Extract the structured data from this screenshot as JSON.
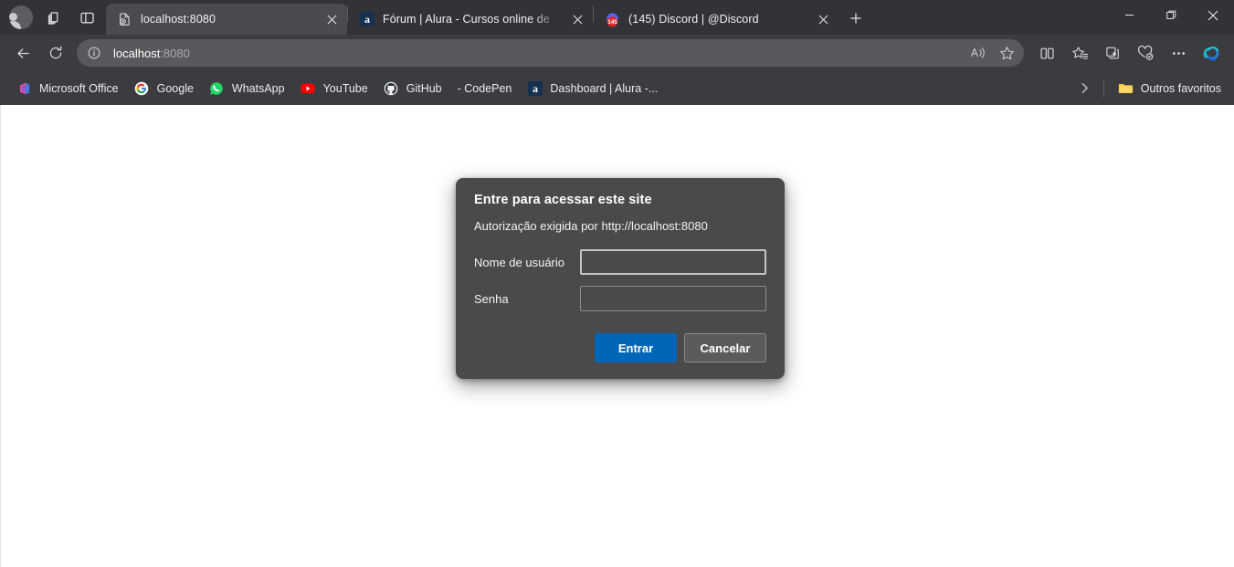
{
  "window": {
    "controls": {
      "minimize": "Minimizar",
      "restore": "Restaurar",
      "close": "Fechar"
    }
  },
  "tabstrip": {
    "profile_label": "Perfil",
    "workspaces_label": "Espaços de trabalho",
    "tab_actions_label": "Ações da guia",
    "new_tab_label": "Nova guia",
    "tabs": [
      {
        "title": "localhost:8080",
        "favicon": "page-error-icon",
        "active": true,
        "close_label": "Fechar guia"
      },
      {
        "title": "Fórum | Alura - Cursos online de",
        "favicon": "alura-icon",
        "active": false,
        "close_label": "Fechar guia"
      },
      {
        "title": "(145) Discord | @Discord",
        "favicon": "discord-icon",
        "badge": "145",
        "active": false,
        "close_label": "Fechar guia"
      }
    ]
  },
  "toolbar": {
    "back_label": "Voltar",
    "refresh_label": "Atualizar",
    "omnibox": {
      "info_label": "Exibir informações do site",
      "url_host": "localhost",
      "url_port": ":8080",
      "read_aloud_label": "Ler em voz alta",
      "favorite_label": "Adicionar esta página aos favoritos"
    },
    "split_screen_label": "Tela dividida",
    "favorites_label": "Favoritos",
    "collections_label": "Coleções",
    "browser_essentials_label": "Browser essentials",
    "settings_label": "Configurações e mais",
    "copilot_label": "Copilot"
  },
  "bookmarks": {
    "items": [
      {
        "label": "Microsoft Office",
        "icon": "office-icon"
      },
      {
        "label": "Google",
        "icon": "google-icon"
      },
      {
        "label": "WhatsApp",
        "icon": "whatsapp-icon"
      },
      {
        "label": "YouTube",
        "icon": "youtube-icon"
      },
      {
        "label": "GitHub",
        "icon": "github-icon"
      },
      {
        "label": "- CodePen",
        "icon": "codepen-icon"
      },
      {
        "label": "Dashboard | Alura -...",
        "icon": "alura-icon"
      }
    ],
    "overflow_label": "Mostrar mais favoritos",
    "other_favorites": {
      "label": "Outros favoritos",
      "icon": "folder-icon"
    }
  },
  "auth_dialog": {
    "title": "Entre para acessar este site",
    "subtitle": "Autorização exigida por http://localhost:8080",
    "username": {
      "label": "Nome de usuário",
      "value": "",
      "placeholder": "",
      "focused": true
    },
    "password": {
      "label": "Senha",
      "value": "",
      "placeholder": "",
      "focused": false
    },
    "submit_label": "Entrar",
    "cancel_label": "Cancelar",
    "colors": {
      "dialog_bg": "#4a4a4c",
      "primary_button": "#0067b8",
      "secondary_button": "#5b5b5d"
    }
  },
  "page": {
    "background": "#ffffff"
  }
}
